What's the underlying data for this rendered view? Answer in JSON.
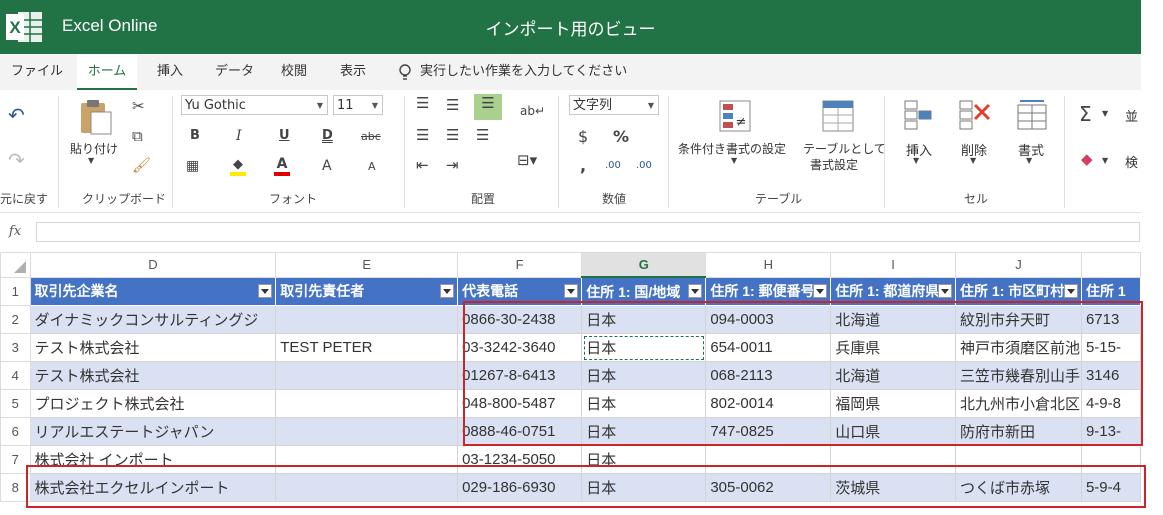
{
  "title_bar": {
    "app_name": "Excel Online",
    "document_title": "インポート用のビュー",
    "bg_color": "#217346"
  },
  "tabs": [
    "ファイル",
    "ホーム",
    "挿入",
    "データ",
    "校閲",
    "表示"
  ],
  "active_tab": "ホーム",
  "tell_me": "実行したい作業を入力してください",
  "ribbon": {
    "undo_group": "元に戻す",
    "clipboard": {
      "paste": "貼り付け",
      "label": "クリップボード"
    },
    "font": {
      "name": "Yu Gothic",
      "size": "11",
      "bold": "B",
      "italic": "I",
      "underline": "U",
      "double_underline": "D",
      "strike": "abc",
      "grow": "A",
      "shrink": "A",
      "label": "フォント"
    },
    "alignment": {
      "label": "配置"
    },
    "number": {
      "format": "文字列",
      "currency": "$",
      "percent": "%",
      "comma": ",",
      "inc_dec": ".00",
      "dec_dec": ".00",
      "label": "数値"
    },
    "table": {
      "cond_format": "条件付き書式の設定",
      "format_as_table_1": "テーブルとして",
      "format_as_table_2": "書式設定",
      "label": "テーブル"
    },
    "cells": {
      "insert": "挿入",
      "delete": "削除",
      "format": "書式",
      "label": "セル"
    },
    "editing": {
      "sort": "並",
      "find": "検"
    }
  },
  "formula_bar": {
    "fx": "fx",
    "value": ""
  },
  "columns": [
    "D",
    "E",
    "F",
    "G",
    "H",
    "I",
    "J"
  ],
  "selected_column": "G",
  "rows": [
    1,
    2,
    3,
    4,
    5,
    6,
    7,
    8
  ],
  "headers": [
    "取引先企業名",
    "取引先責任者",
    "代表電話",
    "住所 1: 国/地域",
    "住所 1: 郵便番号",
    "住所 1: 都道府県",
    "住所 1: 市区町村",
    "住所 1"
  ],
  "data_rows": [
    [
      "ダイナミックコンサルティングジ",
      "",
      "0866-30-2438",
      "日本",
      "094-0003",
      "北海道",
      "紋別市弁天町",
      "6713"
    ],
    [
      "テスト株式会社",
      "TEST PETER",
      "03-3242-3640",
      "日本",
      "654-0011",
      "兵庫県",
      "神戸市須磨区前池",
      "5-15-"
    ],
    [
      "テスト株式会社",
      "",
      "01267-8-6413",
      "日本",
      "068-2113",
      "北海道",
      "三笠市幾春別山手",
      "3146"
    ],
    [
      "プロジェクト株式会社",
      "",
      "048-800-5487",
      "日本",
      "802-0014",
      "福岡県",
      "北九州市小倉北区",
      "4-9-8"
    ],
    [
      "リアルエステートジャパン",
      "",
      "0888-46-0751",
      "日本",
      "747-0825",
      "山口県",
      "防府市新田",
      "9-13-"
    ],
    [
      "株式会社 インポート",
      "",
      "03-1234-5050",
      "日本",
      "",
      "",
      "",
      ""
    ],
    [
      "株式会社エクセルインポート",
      "",
      "029-186-6930",
      "日本",
      "305-0062",
      "茨城県",
      "つくば市赤塚",
      "5-9-4"
    ]
  ]
}
